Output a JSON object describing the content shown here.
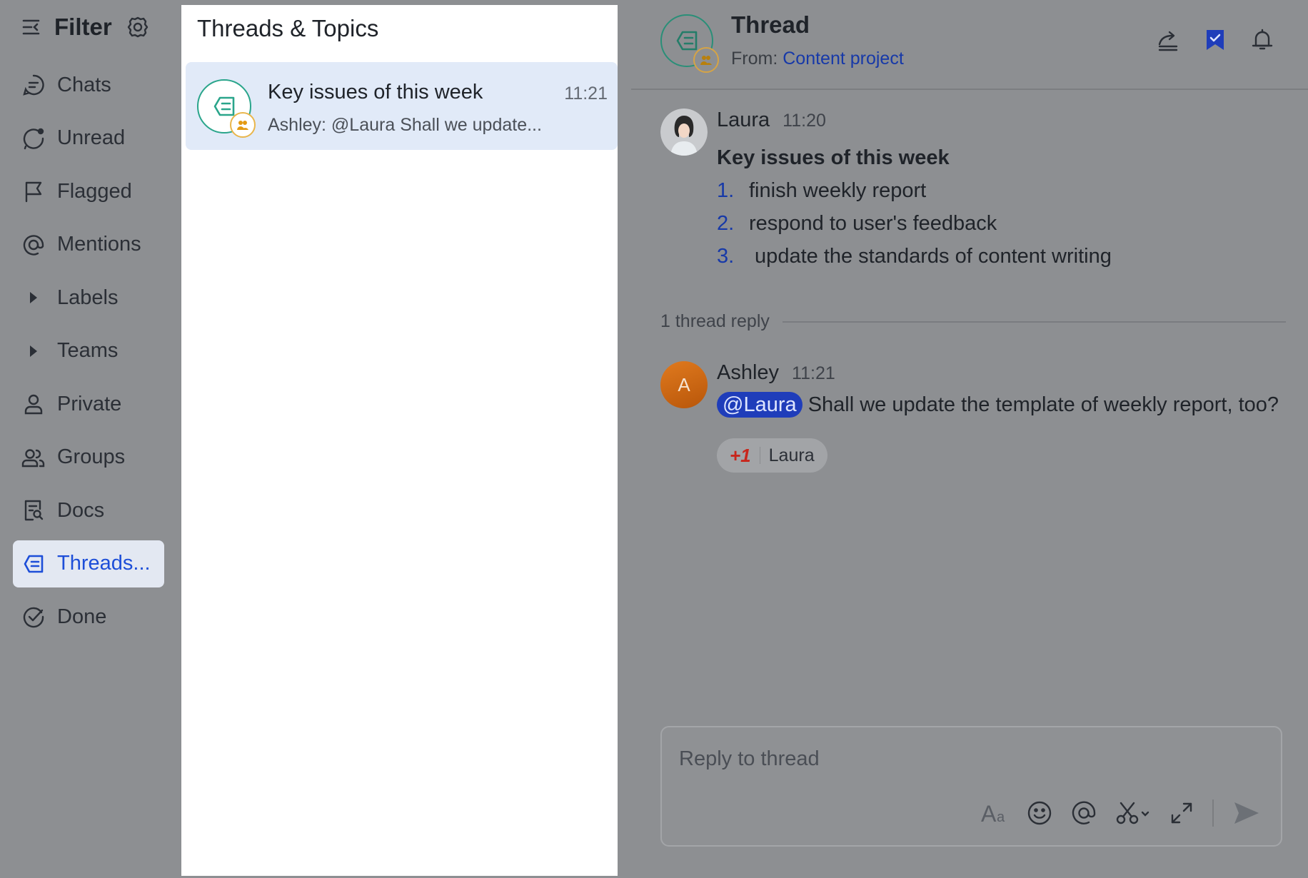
{
  "sidebar": {
    "title": "Filter",
    "items": [
      {
        "label": "Chats",
        "icon": "chat-bubble-icon"
      },
      {
        "label": "Unread",
        "icon": "unread-icon"
      },
      {
        "label": "Flagged",
        "icon": "flag-icon"
      },
      {
        "label": "Mentions",
        "icon": "at-icon"
      },
      {
        "label": "Labels",
        "icon": "caret-right-icon"
      },
      {
        "label": "Teams",
        "icon": "caret-right-icon"
      },
      {
        "label": "Private",
        "icon": "person-icon"
      },
      {
        "label": "Groups",
        "icon": "group-icon"
      },
      {
        "label": "Docs",
        "icon": "doc-icon"
      },
      {
        "label": "Threads...",
        "icon": "thread-icon",
        "active": true
      },
      {
        "label": "Done",
        "icon": "done-icon"
      }
    ]
  },
  "list_panel": {
    "title": "Threads & Topics",
    "threads": [
      {
        "title": "Key issues of this week",
        "time": "11:21",
        "preview": "Ashley: @Laura Shall we update..."
      }
    ]
  },
  "thread": {
    "title": "Thread",
    "from_label": "From:",
    "from_source": "Content project",
    "messages": [
      {
        "author": "Laura",
        "time": "11:20",
        "title": "Key issues of this week",
        "items": [
          {
            "num": "1.",
            "text": "finish weekly report"
          },
          {
            "num": "2.",
            "text": "respond to user's feedback"
          },
          {
            "num": "3.",
            "text": " update the standards of content writing"
          }
        ]
      }
    ],
    "reply_count_label": "1 thread reply",
    "replies": [
      {
        "author": "Ashley",
        "avatar_initial": "A",
        "time": "11:21",
        "mention": "@Laura",
        "text": "Shall we update the template of weekly report, too?",
        "reaction": {
          "emoji": "+1",
          "by": "Laura"
        }
      }
    ],
    "composer": {
      "placeholder": "Reply to thread"
    }
  },
  "colors": {
    "accent": "#1d4ed8",
    "link": "#1739a8",
    "thread_green": "#2aa58b",
    "group_badge": "#e9b64b",
    "active_bg": "#e3e8f2",
    "selected_card": "#e1eaf8"
  }
}
